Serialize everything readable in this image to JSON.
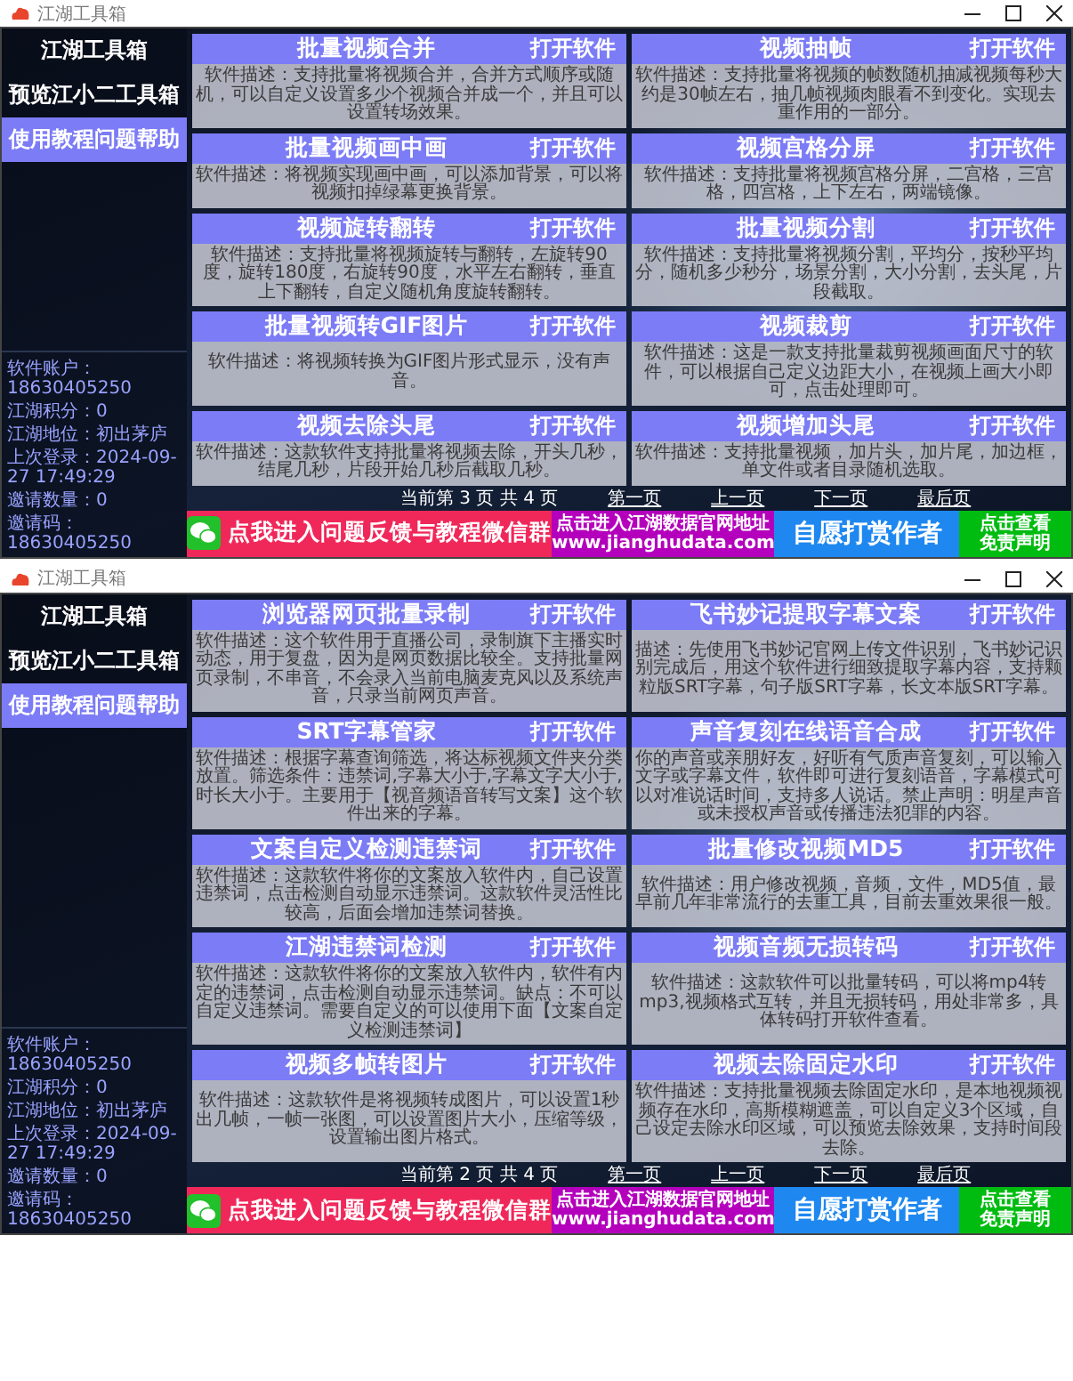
{
  "windows": [
    {
      "title": "江湖工具箱",
      "sidebar": {
        "items": [
          {
            "label": "江湖工具箱",
            "selected": false
          },
          {
            "label": "预览江小二工具箱",
            "selected": false
          },
          {
            "label": "使用教程问题帮助",
            "selected": true
          }
        ],
        "account": [
          "软件账户：18630405250",
          "江湖积分：0",
          "江湖地位：初出茅庐",
          "上次登录：2024-09-27 17:49:29",
          "邀请数量：0",
          "邀请码：18630405250"
        ]
      },
      "tools": [
        {
          "name": "批量视频合并",
          "button": "打开软件",
          "description": "软件描述：支持批量将视频合并，合并方式顺序或随机，可以自定义设置多少个视频合并成一个，并且可以设置转场效果。"
        },
        {
          "name": "视频抽帧",
          "button": "打开软件",
          "description": "软件描述：支持批量将视频的帧数随机抽减视频每秒大约是30帧左右，抽几帧视频肉眼看不到变化。实现去重作用的一部分。"
        },
        {
          "name": "批量视频画中画",
          "button": "打开软件",
          "description": "软件描述：将视频实现画中画，可以添加背景，可以将视频扣掉绿幕更换背景。"
        },
        {
          "name": "视频宫格分屏",
          "button": "打开软件",
          "description": "软件描述：支持批量将视频宫格分屏，二宫格，三宫格，四宫格，上下左右，两端镜像。"
        },
        {
          "name": "视频旋转翻转",
          "button": "打开软件",
          "description": "软件描述：支持批量将视频旋转与翻转，左旋转90度，旋转180度，右旋转90度，水平左右翻转，垂直上下翻转，自定义随机角度旋转翻转。"
        },
        {
          "name": "批量视频分割",
          "button": "打开软件",
          "description": "软件描述：支持批量将视频分割，平均分，按秒平均分，随机多少秒分，场景分割，大小分割，去头尾，片段截取。"
        },
        {
          "name": "批量视频转GIF图片",
          "button": "打开软件",
          "description": "软件描述：将视频转换为GIF图片形式显示，没有声音。"
        },
        {
          "name": "视频裁剪",
          "button": "打开软件",
          "description": "软件描述：这是一款支持批量裁剪视频画面尺寸的软件，可以根据自己定义边距大小，在视频上画大小即可，点击处理即可。"
        },
        {
          "name": "视频去除头尾",
          "button": "打开软件",
          "description": "软件描述：这款软件支持批量将视频去除，开头几秒，结尾几秒，片段开始几秒后截取几秒。"
        },
        {
          "name": "视频增加头尾",
          "button": "打开软件",
          "description": "软件描述：支持批量视频，加片头，加片尾，加边框，单文件或者目录随机选取。"
        }
      ],
      "pagination": {
        "status": "当前第 3 页 共 4 页",
        "links": [
          "第一页",
          "上一页",
          "下一页",
          "最后页"
        ]
      },
      "footer": [
        {
          "kind": "wechat",
          "lines": [
            "点我进入问题反馈与教程微信群"
          ]
        },
        {
          "kind": "website",
          "lines": [
            "点击进入江湖数据官网地址",
            "www.jianghudata.com"
          ]
        },
        {
          "kind": "donate",
          "lines": [
            "自愿打赏作者"
          ]
        },
        {
          "kind": "disclaimer",
          "lines": [
            "点击查看",
            "免责声明"
          ]
        }
      ]
    },
    {
      "title": "江湖工具箱",
      "sidebar": {
        "items": [
          {
            "label": "江湖工具箱",
            "selected": false
          },
          {
            "label": "预览江小二工具箱",
            "selected": false
          },
          {
            "label": "使用教程问题帮助",
            "selected": true
          }
        ],
        "account": [
          "软件账户：18630405250",
          "江湖积分：0",
          "江湖地位：初出茅庐",
          "上次登录：2024-09-27 17:49:29",
          "邀请数量：0",
          "邀请码：18630405250"
        ]
      },
      "tools": [
        {
          "name": "浏览器网页批量录制",
          "button": "打开软件",
          "description": "软件描述：这个软件用于直播公司，录制旗下主播实时动态，用于复盘，因为是网页数据比较全。支持批量网页录制，不串音，不会录入当前电脑麦克风以及系统声音，只录当前网页声音。"
        },
        {
          "name": "飞书妙记提取字幕文案",
          "button": "打开软件",
          "description": "描述：先使用飞书妙记官网上传文件识别，飞书妙记识别完成后，用这个软件进行细致提取字幕内容，支持颗粒版SRT字幕，句子版SRT字幕，长文本版SRT字幕。"
        },
        {
          "name": "SRT字幕管家",
          "button": "打开软件",
          "description": "软件描述：根据字幕查询筛选，将达标视频文件夹分类放置。筛选条件：违禁词,字幕大小于,字幕文字大小于,时长大小于。主要用于【视音频语音转写文案】这个软件出来的字幕。"
        },
        {
          "name": "声音复刻在线语音合成",
          "button": "打开软件",
          "description": "你的声音或亲朋好友，好听有气质声音复刻，可以输入文字或字幕文件，软件即可进行复刻语音，字幕模式可以对准说话时间，支持多人说话。禁止声明：明星声音或未授权声音或传播违法犯罪的内容。"
        },
        {
          "name": "文案自定义检测违禁词",
          "button": "打开软件",
          "description": "软件描述：这款软件将你的文案放入软件内，自己设置违禁词，点击检测自动显示违禁词。这款软件灵活性比较高，后面会增加违禁词替换。"
        },
        {
          "name": "批量修改视频MD5",
          "button": "打开软件",
          "description": "软件描述：用户修改视频，音频，文件，MD5值，最早前几年非常流行的去重工具，目前去重效果很一般。"
        },
        {
          "name": "江湖违禁词检测",
          "button": "打开软件",
          "description": "软件描述：这款软件将你的文案放入软件内，软件有内定的违禁词，点击检测自动显示违禁词。缺点：不可以自定义违禁词。需要自定义的可以使用下面【文案自定义检测违禁词】"
        },
        {
          "name": "视频音频无损转码",
          "button": "打开软件",
          "description": "软件描述：这款软件可以批量转码，可以将mp4转mp3,视频格式互转，并且无损转码，用处非常多，具体转码打开软件查看。"
        },
        {
          "name": "视频多帧转图片",
          "button": "打开软件",
          "description": "软件描述：这款软件是将视频转成图片，可以设置1秒出几帧，一帧一张图，可以设置图片大小，压缩等级，设置输出图片格式。"
        },
        {
          "name": "视频去除固定水印",
          "button": "打开软件",
          "description": "软件描述：支持批量视频去除固定水印，是本地视频视频存在水印，高斯模糊遮盖，可以自定义3个区域，自己设定去除水印区域，可以预览去除效果，支持时间段去除。"
        }
      ],
      "pagination": {
        "status": "当前第 2 页 共 4 页",
        "links": [
          "第一页",
          "上一页",
          "下一页",
          "最后页"
        ]
      },
      "footer": [
        {
          "kind": "wechat",
          "lines": [
            "点我进入问题反馈与教程微信群"
          ]
        },
        {
          "kind": "website",
          "lines": [
            "点击进入江湖数据官网地址",
            "www.jianghudata.com"
          ]
        },
        {
          "kind": "donate",
          "lines": [
            "自愿打赏作者"
          ]
        },
        {
          "kind": "disclaimer",
          "lines": [
            "点击查看",
            "免责声明"
          ]
        }
      ]
    }
  ]
}
